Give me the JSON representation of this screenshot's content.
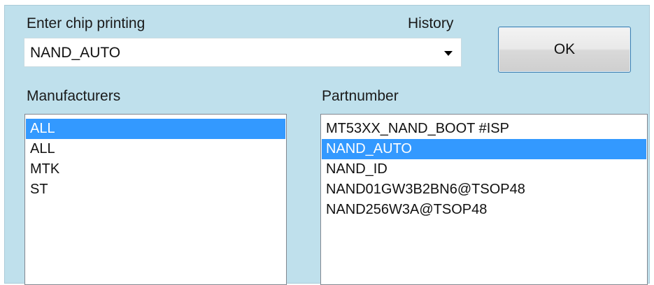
{
  "dialog": {
    "chip_label": "Enter chip printing",
    "history_label": "History",
    "chip_value": "NAND_AUTO",
    "ok_label": "OK"
  },
  "manufacturers": {
    "label": "Manufacturers",
    "items": [
      {
        "label": "ALL",
        "selected": true
      },
      {
        "label": "ALL",
        "selected": false
      },
      {
        "label": "MTK",
        "selected": false
      },
      {
        "label": "ST",
        "selected": false
      }
    ]
  },
  "partnumbers": {
    "label": "Partnumber",
    "items": [
      {
        "label": "MT53XX_NAND_BOOT #ISP",
        "selected": false
      },
      {
        "label": "NAND_AUTO",
        "selected": true
      },
      {
        "label": "NAND_ID",
        "selected": false
      },
      {
        "label": "NAND01GW3B2BN6@TSOP48",
        "selected": false
      },
      {
        "label": "NAND256W3A@TSOP48",
        "selected": false
      }
    ]
  },
  "colors": {
    "background": "#bfe0ec",
    "selection": "#3399ff"
  },
  "icons": {
    "dropdown": "chevron-down-icon"
  }
}
